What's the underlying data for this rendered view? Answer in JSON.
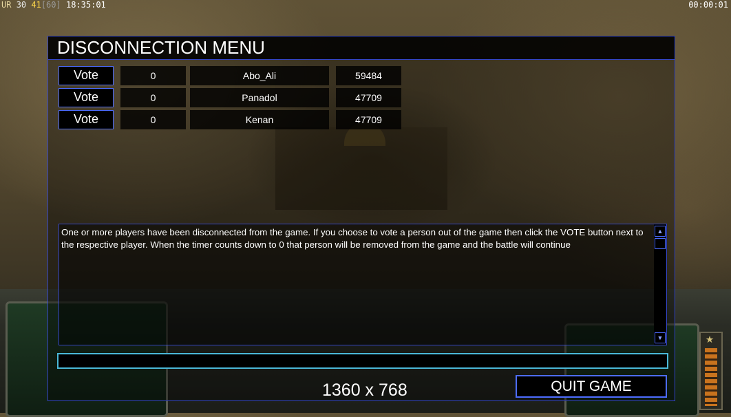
{
  "hud": {
    "left": {
      "ur": "UR",
      "v1": "30",
      "v2": "41",
      "v3": "[60]",
      "time": "18:35:01"
    },
    "right": "00:00:01"
  },
  "dialog": {
    "title": "DISCONNECTION MENU",
    "players": [
      {
        "vote_label": "Vote",
        "count": "0",
        "name": "Abo_Ali",
        "ping": "59484"
      },
      {
        "vote_label": "Vote",
        "count": "0",
        "name": "Panadol",
        "ping": "47709"
      },
      {
        "vote_label": "Vote",
        "count": "0",
        "name": "Kenan",
        "ping": "47709"
      }
    ],
    "message": "One or more players have been disconnected from the game. If you choose to vote a person out of the game then click the VOTE button next to the respective player. When the timer counts down to 0 that person will be removed from the game and the battle will continue",
    "chat_value": "",
    "resolution": "1360 x 768",
    "quit_label": "QUIT GAME"
  },
  "colors": {
    "accent": "#4d6cff",
    "input_border": "#4ab8d8",
    "fps_yellow": "#ffd84a"
  }
}
